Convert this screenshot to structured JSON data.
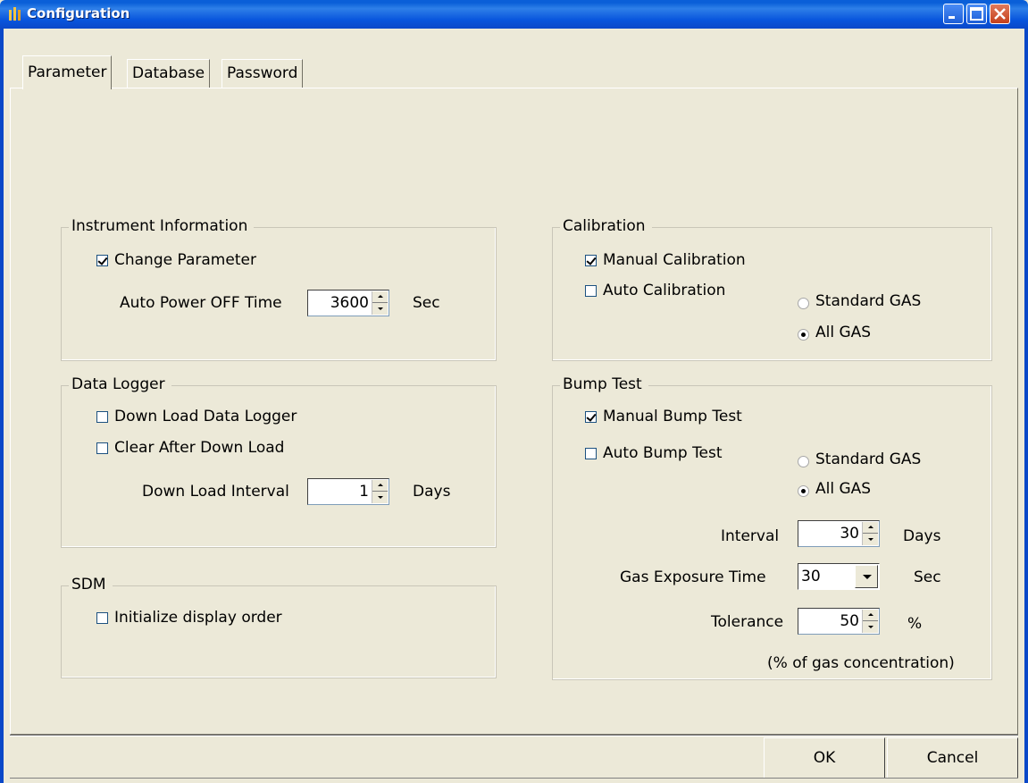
{
  "window": {
    "title": "Configuration"
  },
  "tabs": [
    {
      "label": "Parameter",
      "active": true
    },
    {
      "label": "Database",
      "active": false
    },
    {
      "label": "Password",
      "active": false
    }
  ],
  "instrument_information": {
    "title": "Instrument Information",
    "change_parameter": {
      "label": "Change Parameter",
      "checked": true
    },
    "auto_power_off": {
      "label": "Auto Power OFF Time",
      "value": "3600",
      "unit": "Sec"
    }
  },
  "data_logger": {
    "title": "Data Logger",
    "download": {
      "label": "Down Load Data Logger",
      "checked": false
    },
    "clear_after": {
      "label": "Clear After Down Load",
      "checked": false
    },
    "interval": {
      "label": "Down Load Interval",
      "value": "1",
      "unit": "Days"
    }
  },
  "sdm": {
    "title": "SDM",
    "initialize": {
      "label": "Initialize display order",
      "checked": false
    }
  },
  "calibration": {
    "title": "Calibration",
    "manual": {
      "label": "Manual Calibration",
      "checked": true
    },
    "auto": {
      "label": "Auto Calibration",
      "checked": false
    },
    "standard_gas": {
      "label": "Standard GAS",
      "selected": false
    },
    "all_gas": {
      "label": "All GAS",
      "selected": true
    }
  },
  "bump_test": {
    "title": "Bump Test",
    "manual": {
      "label": "Manual Bump Test",
      "checked": true
    },
    "auto": {
      "label": "Auto Bump Test",
      "checked": false
    },
    "standard_gas": {
      "label": "Standard GAS",
      "selected": false
    },
    "all_gas": {
      "label": "All GAS",
      "selected": true
    },
    "interval": {
      "label": "Interval",
      "value": "30",
      "unit": "Days"
    },
    "exposure": {
      "label": "Gas Exposure Time",
      "value": "30",
      "unit": "Sec"
    },
    "tolerance": {
      "label": "Tolerance",
      "value": "50",
      "unit": "%"
    },
    "note": "(% of gas concentration)"
  },
  "buttons": {
    "ok": "OK",
    "cancel": "Cancel"
  }
}
